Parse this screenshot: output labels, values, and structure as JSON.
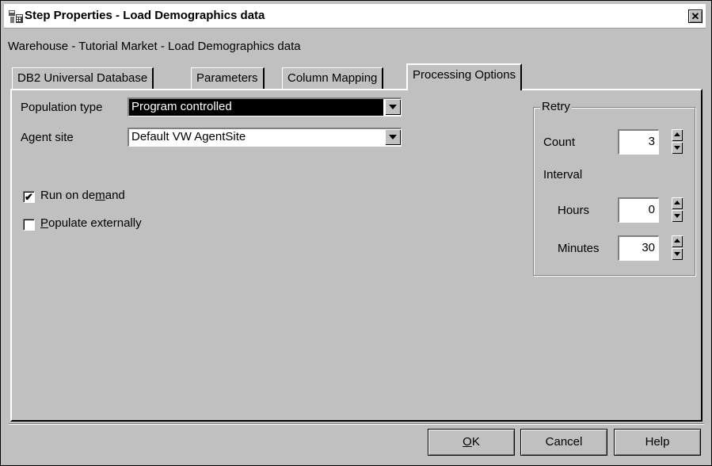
{
  "window": {
    "title": "Step Properties - Load Demographics data",
    "close_glyph": "✕"
  },
  "breadcrumb": "Warehouse - Tutorial Market - Load Demographics data",
  "tabs": [
    {
      "label": "DB2 Universal Database",
      "active": false
    },
    {
      "label": "Parameters",
      "active": false
    },
    {
      "label": "Column Mapping",
      "active": false
    },
    {
      "label": "Processing Options",
      "active": true
    }
  ],
  "form": {
    "population_type": {
      "label": "Population type",
      "value": "Program controlled"
    },
    "agent_site": {
      "label": "Agent site",
      "value": "Default VW AgentSite"
    },
    "run_on_demand": {
      "label_pre": "Run on de",
      "label_mnemonic": "m",
      "label_post": "and",
      "checked": true,
      "check_glyph": "✔"
    },
    "populate_externally": {
      "label_mnemonic": "P",
      "label_post": "opulate externally",
      "checked": false
    }
  },
  "retry": {
    "group_label": "Retry",
    "count_label": "Count",
    "count_value": "3",
    "interval_label": "Interval",
    "hours_label": "Hours",
    "hours_value": "0",
    "minutes_label": "Minutes",
    "minutes_value": "30"
  },
  "buttons": {
    "ok_mnemonic": "O",
    "ok_rest": "K",
    "cancel": "Cancel",
    "help": "Help"
  },
  "icons": [
    "app-icon",
    "close-icon",
    "dropdown-arrow-icon",
    "spin-up-icon",
    "spin-down-icon",
    "checkmark-icon"
  ]
}
